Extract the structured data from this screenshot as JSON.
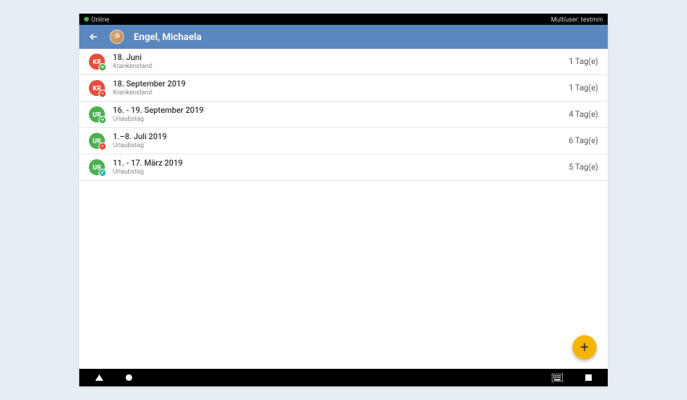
{
  "status_bar": {
    "online": "Online",
    "multiuser": "Multiuser: testmm"
  },
  "header": {
    "title": "Engel, Michaela"
  },
  "colors": {
    "header_bg": "#5b87c0",
    "fab_bg": "#f5b400",
    "red": "#e74c3c",
    "green": "#4caf50"
  },
  "entries": [
    {
      "date": "18. Juni",
      "type": "Krankenstand",
      "days": "1 Tag(e)",
      "icon_color": "red",
      "icon_text": "KR",
      "badge_color": "green",
      "badge_sym": "+"
    },
    {
      "date": "18. September 2019",
      "type": "Krankenstand",
      "days": "1 Tag(e)",
      "icon_color": "red",
      "icon_text": "KR",
      "badge_color": "red",
      "badge_sym": "−"
    },
    {
      "date": "16. - 19. September 2019",
      "type": "Urlaubstag",
      "days": "4 Tag(e)",
      "icon_color": "green",
      "icon_text": "UR",
      "badge_color": "green",
      "badge_sym": "+"
    },
    {
      "date": "1.–8. Juli 2019",
      "type": "Urlaubstag",
      "days": "6 Tag(e)",
      "icon_color": "green",
      "icon_text": "UR",
      "badge_color": "red",
      "badge_sym": "−"
    },
    {
      "date": "11. - 17. März 2019",
      "type": "Urlaubstag",
      "days": "5 Tag(e)",
      "icon_color": "green",
      "icon_text": "UR",
      "badge_color": "teal",
      "badge_sym": "✓"
    }
  ],
  "fab": {
    "label": "+"
  }
}
